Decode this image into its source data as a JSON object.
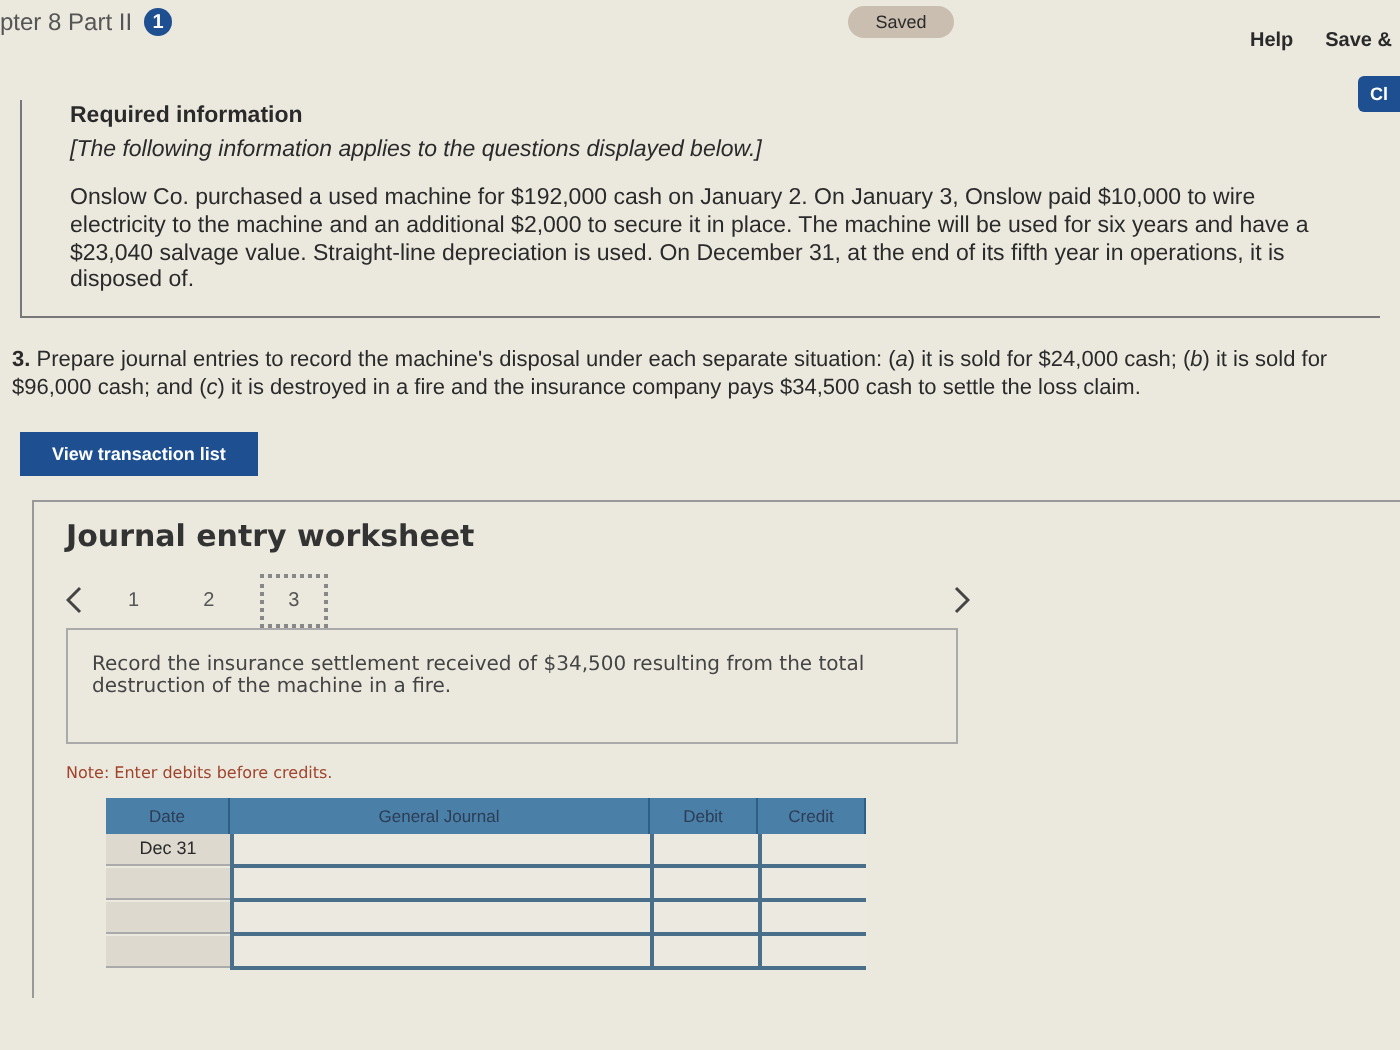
{
  "header": {
    "title": "pter 8 Part II",
    "badge": "1",
    "status": "Saved",
    "links": [
      "Help",
      "Save &"
    ],
    "side_button": "Cl"
  },
  "required_info": {
    "title": "Required information",
    "note": "[The following information applies to the questions displayed below.]",
    "body": "Onslow Co. purchased a used machine for $192,000 cash on January 2. On January 3, Onslow paid $10,000 to wire electricity to the machine and an additional $2,000 to secure it in place. The machine will be used for six years and have a $23,040 salvage value. Straight-line depreciation is used. On December 31, at the end of its fifth year in operations, it is disposed of."
  },
  "question": {
    "number": "3.",
    "text": "Prepare journal entries to record the machine's disposal under each separate situation: (*a*) it is sold for $24,000 cash; (*b*) it is sold for $96,000 cash; and (*c*) it is destroyed in a fire and the insurance company pays $34,500 cash to settle the loss claim."
  },
  "view_button": "View transaction list",
  "worksheet": {
    "title": "Journal entry worksheet",
    "pages": [
      {
        "label": "1",
        "selected": false
      },
      {
        "label": "2",
        "selected": false
      },
      {
        "label": "3",
        "selected": true
      }
    ],
    "instruction": "Record the insurance settlement received of $34,500 resulting from the total destruction of the machine in a fire.",
    "note": "Note: Enter debits before credits.",
    "table": {
      "columns": [
        "Date",
        "General Journal",
        "Debit",
        "Credit"
      ],
      "rows": [
        {
          "date": "Dec 31"
        },
        {},
        {},
        {}
      ]
    }
  }
}
